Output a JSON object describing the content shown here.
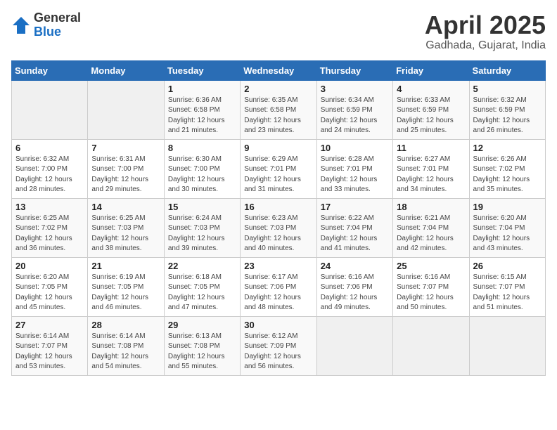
{
  "logo": {
    "general": "General",
    "blue": "Blue"
  },
  "title": "April 2025",
  "location": "Gadhada, Gujarat, India",
  "days_of_week": [
    "Sunday",
    "Monday",
    "Tuesday",
    "Wednesday",
    "Thursday",
    "Friday",
    "Saturday"
  ],
  "weeks": [
    [
      {
        "day": null,
        "info": null
      },
      {
        "day": null,
        "info": null
      },
      {
        "day": "1",
        "info": "Sunrise: 6:36 AM\nSunset: 6:58 PM\nDaylight: 12 hours\nand 21 minutes."
      },
      {
        "day": "2",
        "info": "Sunrise: 6:35 AM\nSunset: 6:58 PM\nDaylight: 12 hours\nand 23 minutes."
      },
      {
        "day": "3",
        "info": "Sunrise: 6:34 AM\nSunset: 6:59 PM\nDaylight: 12 hours\nand 24 minutes."
      },
      {
        "day": "4",
        "info": "Sunrise: 6:33 AM\nSunset: 6:59 PM\nDaylight: 12 hours\nand 25 minutes."
      },
      {
        "day": "5",
        "info": "Sunrise: 6:32 AM\nSunset: 6:59 PM\nDaylight: 12 hours\nand 26 minutes."
      }
    ],
    [
      {
        "day": "6",
        "info": "Sunrise: 6:32 AM\nSunset: 7:00 PM\nDaylight: 12 hours\nand 28 minutes."
      },
      {
        "day": "7",
        "info": "Sunrise: 6:31 AM\nSunset: 7:00 PM\nDaylight: 12 hours\nand 29 minutes."
      },
      {
        "day": "8",
        "info": "Sunrise: 6:30 AM\nSunset: 7:00 PM\nDaylight: 12 hours\nand 30 minutes."
      },
      {
        "day": "9",
        "info": "Sunrise: 6:29 AM\nSunset: 7:01 PM\nDaylight: 12 hours\nand 31 minutes."
      },
      {
        "day": "10",
        "info": "Sunrise: 6:28 AM\nSunset: 7:01 PM\nDaylight: 12 hours\nand 33 minutes."
      },
      {
        "day": "11",
        "info": "Sunrise: 6:27 AM\nSunset: 7:01 PM\nDaylight: 12 hours\nand 34 minutes."
      },
      {
        "day": "12",
        "info": "Sunrise: 6:26 AM\nSunset: 7:02 PM\nDaylight: 12 hours\nand 35 minutes."
      }
    ],
    [
      {
        "day": "13",
        "info": "Sunrise: 6:25 AM\nSunset: 7:02 PM\nDaylight: 12 hours\nand 36 minutes."
      },
      {
        "day": "14",
        "info": "Sunrise: 6:25 AM\nSunset: 7:03 PM\nDaylight: 12 hours\nand 38 minutes."
      },
      {
        "day": "15",
        "info": "Sunrise: 6:24 AM\nSunset: 7:03 PM\nDaylight: 12 hours\nand 39 minutes."
      },
      {
        "day": "16",
        "info": "Sunrise: 6:23 AM\nSunset: 7:03 PM\nDaylight: 12 hours\nand 40 minutes."
      },
      {
        "day": "17",
        "info": "Sunrise: 6:22 AM\nSunset: 7:04 PM\nDaylight: 12 hours\nand 41 minutes."
      },
      {
        "day": "18",
        "info": "Sunrise: 6:21 AM\nSunset: 7:04 PM\nDaylight: 12 hours\nand 42 minutes."
      },
      {
        "day": "19",
        "info": "Sunrise: 6:20 AM\nSunset: 7:04 PM\nDaylight: 12 hours\nand 43 minutes."
      }
    ],
    [
      {
        "day": "20",
        "info": "Sunrise: 6:20 AM\nSunset: 7:05 PM\nDaylight: 12 hours\nand 45 minutes."
      },
      {
        "day": "21",
        "info": "Sunrise: 6:19 AM\nSunset: 7:05 PM\nDaylight: 12 hours\nand 46 minutes."
      },
      {
        "day": "22",
        "info": "Sunrise: 6:18 AM\nSunset: 7:05 PM\nDaylight: 12 hours\nand 47 minutes."
      },
      {
        "day": "23",
        "info": "Sunrise: 6:17 AM\nSunset: 7:06 PM\nDaylight: 12 hours\nand 48 minutes."
      },
      {
        "day": "24",
        "info": "Sunrise: 6:16 AM\nSunset: 7:06 PM\nDaylight: 12 hours\nand 49 minutes."
      },
      {
        "day": "25",
        "info": "Sunrise: 6:16 AM\nSunset: 7:07 PM\nDaylight: 12 hours\nand 50 minutes."
      },
      {
        "day": "26",
        "info": "Sunrise: 6:15 AM\nSunset: 7:07 PM\nDaylight: 12 hours\nand 51 minutes."
      }
    ],
    [
      {
        "day": "27",
        "info": "Sunrise: 6:14 AM\nSunset: 7:07 PM\nDaylight: 12 hours\nand 53 minutes."
      },
      {
        "day": "28",
        "info": "Sunrise: 6:14 AM\nSunset: 7:08 PM\nDaylight: 12 hours\nand 54 minutes."
      },
      {
        "day": "29",
        "info": "Sunrise: 6:13 AM\nSunset: 7:08 PM\nDaylight: 12 hours\nand 55 minutes."
      },
      {
        "day": "30",
        "info": "Sunrise: 6:12 AM\nSunset: 7:09 PM\nDaylight: 12 hours\nand 56 minutes."
      },
      {
        "day": null,
        "info": null
      },
      {
        "day": null,
        "info": null
      },
      {
        "day": null,
        "info": null
      }
    ]
  ]
}
